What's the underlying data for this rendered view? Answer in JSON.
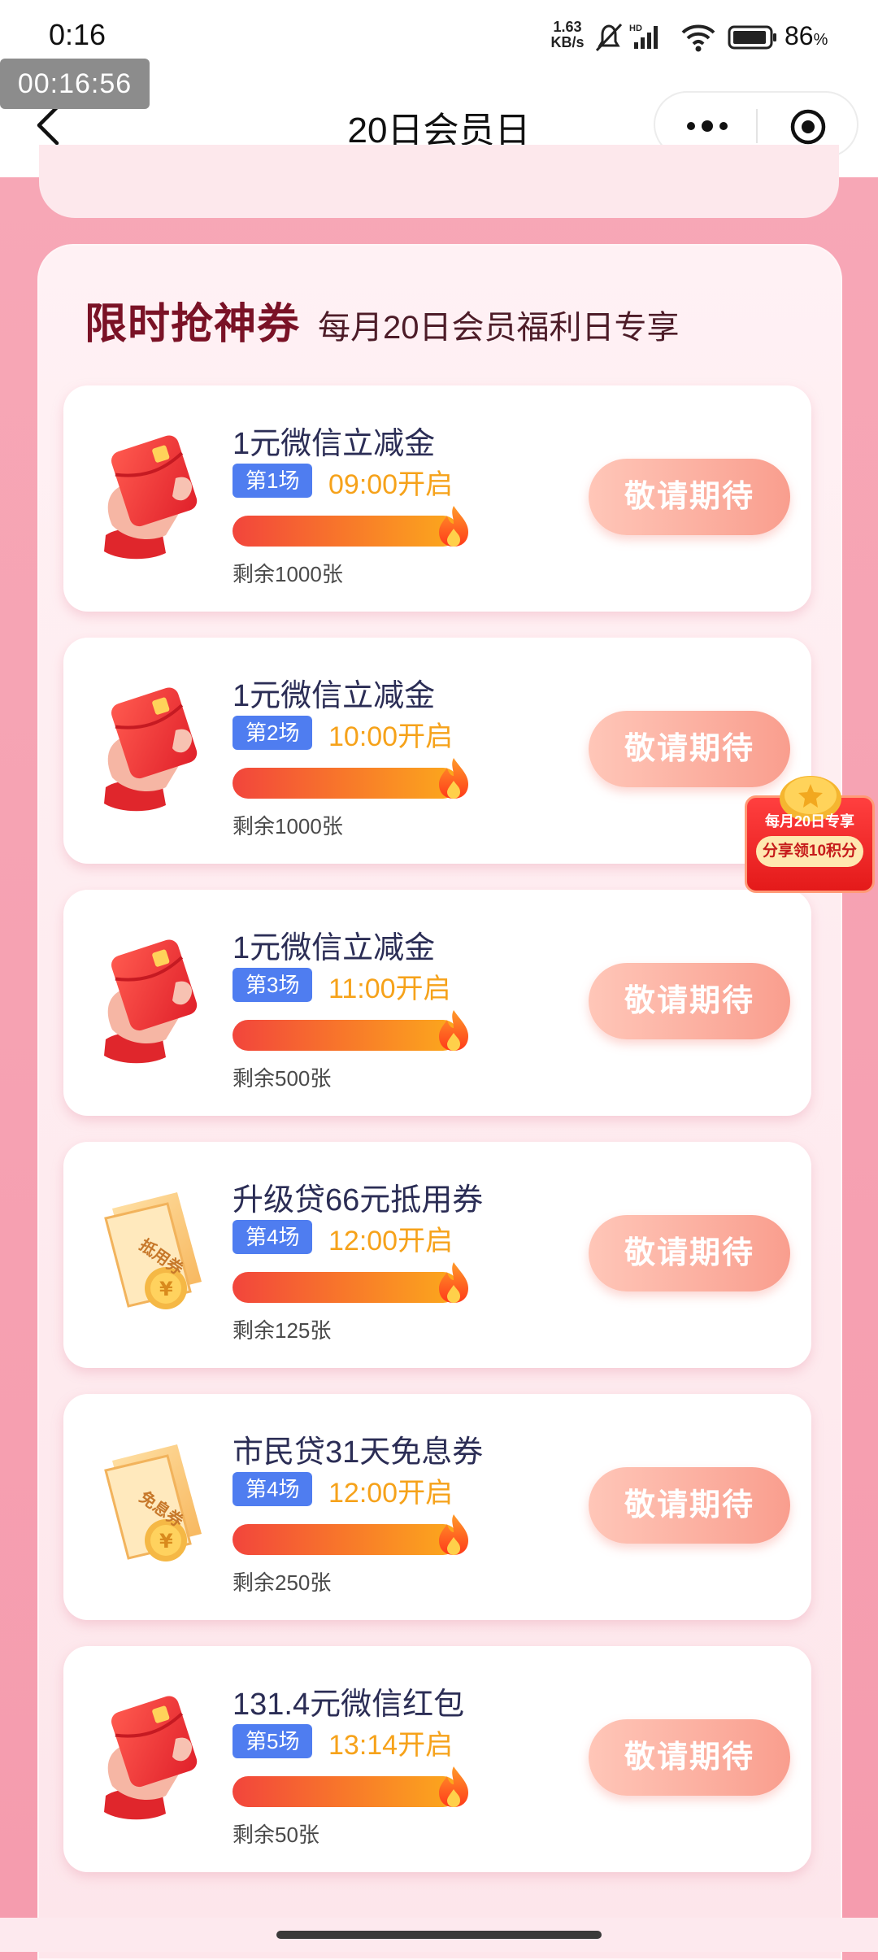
{
  "status_bar": {
    "time": "0:16",
    "net_speed_value": "1.63",
    "net_speed_unit": "KB/s",
    "battery_percent": "86",
    "battery_unit": "%"
  },
  "timer_overlay": "00:16:56",
  "nav": {
    "title": "20日会员日"
  },
  "section": {
    "title": "限时抢神券",
    "subtitle": "每月20日会员福利日专享"
  },
  "coupons": [
    {
      "name": "1元微信立减金",
      "round": "第1场",
      "time": "09:00开启",
      "remaining": "剩余1000张",
      "button": "敬请期待",
      "art": "red-envelope"
    },
    {
      "name": "1元微信立减金",
      "round": "第2场",
      "time": "10:00开启",
      "remaining": "剩余1000张",
      "button": "敬请期待",
      "art": "red-envelope"
    },
    {
      "name": "1元微信立减金",
      "round": "第3场",
      "time": "11:00开启",
      "remaining": "剩余500张",
      "button": "敬请期待",
      "art": "red-envelope"
    },
    {
      "name": "升级贷66元抵用券",
      "round": "第4场",
      "time": "12:00开启",
      "remaining": "剩余125张",
      "button": "敬请期待",
      "art": "voucher",
      "art_text": "抵用券"
    },
    {
      "name": "市民贷31天免息券",
      "round": "第4场",
      "time": "12:00开启",
      "remaining": "剩余250张",
      "button": "敬请期待",
      "art": "voucher",
      "art_text": "免息券"
    },
    {
      "name": "131.4元微信红包",
      "round": "第5场",
      "time": "13:14开启",
      "remaining": "剩余50张",
      "button": "敬请期待",
      "art": "red-envelope"
    }
  ],
  "share_float": {
    "line1": "每月20日专享",
    "line2": "分享领10积分"
  },
  "colors": {
    "page_bg": "#f7a3b4",
    "title_red": "#7a1226",
    "badge_blue": "#4f7df0",
    "time_orange": "#f6a21a",
    "button_coral": "#f99e8e"
  }
}
